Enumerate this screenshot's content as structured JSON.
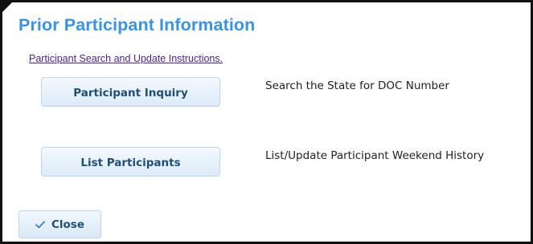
{
  "dialog": {
    "title": "Prior Participant Information",
    "instructions_link": "Participant Search and Update Instructions."
  },
  "actions": [
    {
      "button_label": "Participant Inquiry",
      "description": "Search the State for DOC Number"
    },
    {
      "button_label": "List Participants",
      "description": "List/Update Participant Weekend History"
    }
  ],
  "footer": {
    "close_label": "Close",
    "close_icon": "check-icon"
  }
}
